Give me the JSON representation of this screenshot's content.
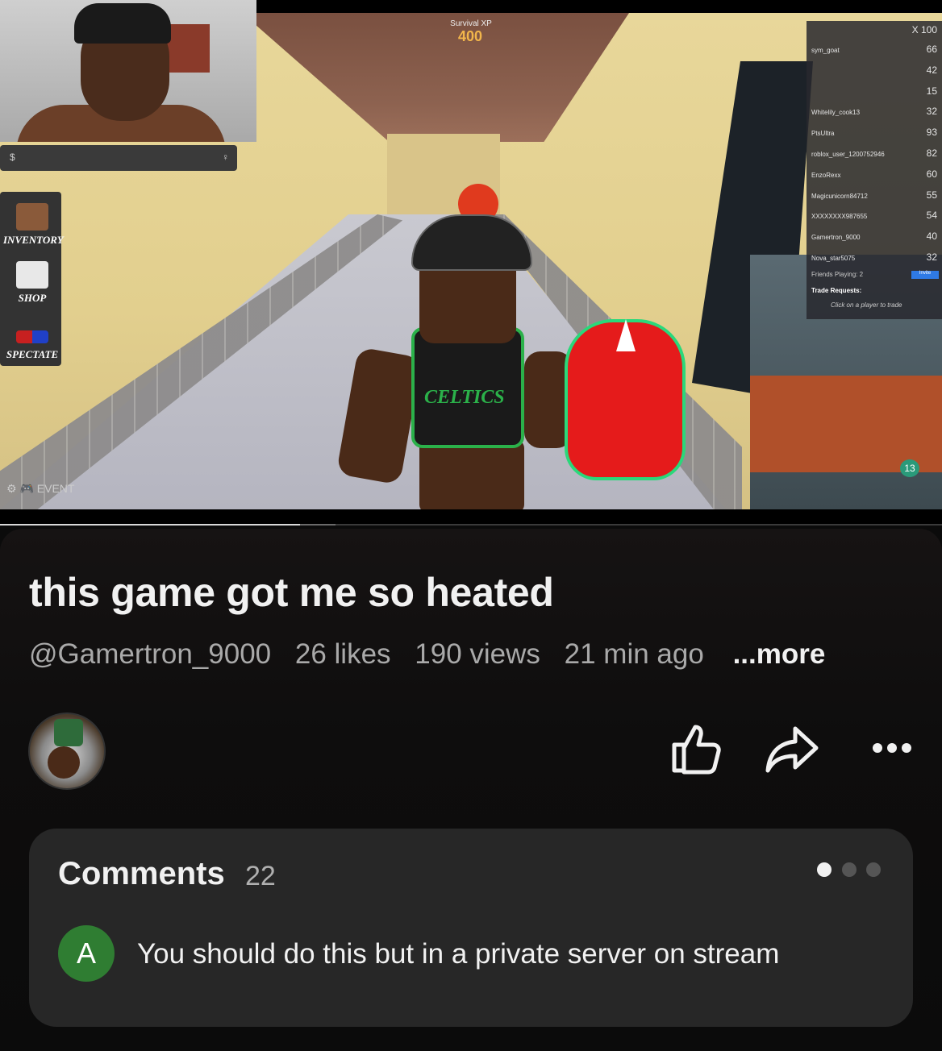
{
  "video": {
    "hud": {
      "xp_label": "Survival XP",
      "xp_value": "400",
      "chat_left": "$",
      "chat_right": "♀",
      "sidebar": [
        {
          "label": "INVENTORY",
          "icon": "crate-icon"
        },
        {
          "label": "SHOP",
          "icon": "money-bag-icon"
        },
        {
          "label": "SPECTATE",
          "icon": "3d-glasses-icon"
        }
      ],
      "bottom_icons": "⚙ 🎮 EVENT",
      "coins": "13",
      "leaderboard": [
        {
          "name": "sym_goat",
          "score": "66"
        },
        {
          "name": "",
          "score": "42"
        },
        {
          "name": "",
          "score": "15"
        },
        {
          "name": "Whitelily_cook13",
          "score": "32"
        },
        {
          "name": "PtsUltra",
          "score": "93"
        },
        {
          "name": "roblox_user_1200752946",
          "score": "82"
        },
        {
          "name": "EnzoRexx",
          "score": "60"
        },
        {
          "name": "Magicunicorn84712",
          "score": "55"
        },
        {
          "name": "XXXXXXXX987655",
          "score": "54"
        },
        {
          "name": "Gamertron_9000",
          "score": "40"
        },
        {
          "name": "Nova_star5075",
          "score": "32"
        }
      ],
      "leaderboard_header": "X 100",
      "friends_playing": "Friends Playing: 2",
      "invite": "Invite",
      "trade_requests": "Trade Requests:",
      "trade_hint": "Click on a player to trade",
      "jersey": "CELTICS"
    },
    "progress": 0.32
  },
  "title": "this game got me so heated",
  "meta": {
    "channel": "@Gamertron_9000",
    "likes": "26 likes",
    "views": "190 views",
    "age": "21 min ago",
    "more": "...more"
  },
  "actions": {
    "like_icon": "thumbs-up-icon",
    "share_icon": "share-icon",
    "more_icon": "more-icon"
  },
  "comments": {
    "heading": "Comments",
    "count": "22",
    "first": {
      "avatar_letter": "A",
      "avatar_color": "#2f7d32",
      "text": "You should do this but in a private server on stream"
    }
  }
}
